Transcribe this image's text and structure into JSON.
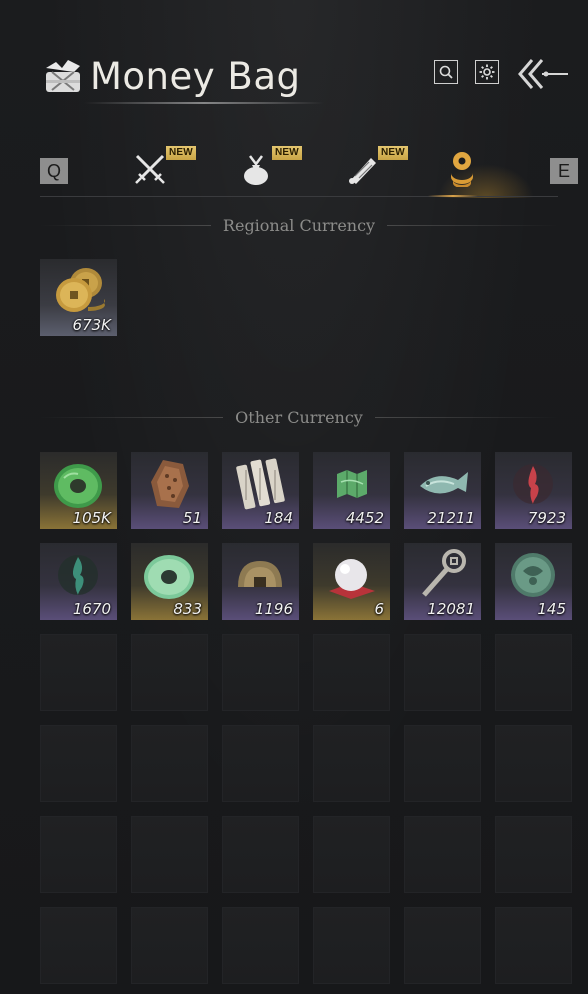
{
  "header": {
    "title": "Money Bag",
    "icons": {
      "bag": "money-bag-icon",
      "search": "search-icon",
      "settings": "gear-icon",
      "back": "back-arrows-icon"
    }
  },
  "tabs": {
    "prev_key": "Q",
    "next_key": "E",
    "items": [
      {
        "icon": "crossed-swords-icon",
        "badge": "NEW",
        "active": false
      },
      {
        "icon": "bundle-icon",
        "badge": "NEW",
        "active": false
      },
      {
        "icon": "scroll-icon",
        "badge": "NEW",
        "active": false
      },
      {
        "icon": "coin-stack-icon",
        "badge": "",
        "active": true
      }
    ],
    "accent": "#d9a24a"
  },
  "regional": {
    "title": "Regional Currency",
    "items": [
      {
        "icon": "copper-coins-icon",
        "count": "673K",
        "quality": "gray"
      }
    ]
  },
  "other": {
    "title": "Other Currency",
    "items": [
      {
        "icon": "jade-ring-icon",
        "count": "105K",
        "quality": "gold"
      },
      {
        "icon": "bronze-token-icon",
        "count": "51",
        "quality": "purple"
      },
      {
        "icon": "paper-slips-icon",
        "count": "184",
        "quality": "purple"
      },
      {
        "icon": "map-icon",
        "count": "4452",
        "quality": "purple"
      },
      {
        "icon": "jade-fish-icon",
        "count": "21211",
        "quality": "purple"
      },
      {
        "icon": "red-flame-icon",
        "count": "7923",
        "quality": "purple"
      },
      {
        "icon": "green-flame-icon",
        "count": "1670",
        "quality": "purple"
      },
      {
        "icon": "jade-disc-icon",
        "count": "833",
        "quality": "gold"
      },
      {
        "icon": "bronze-dome-icon",
        "count": "1196",
        "quality": "purple"
      },
      {
        "icon": "pearl-icon",
        "count": "6",
        "quality": "gold"
      },
      {
        "icon": "coin-sword-icon",
        "count": "12081",
        "quality": "purple"
      },
      {
        "icon": "jade-medallion-icon",
        "count": "145",
        "quality": "purple"
      }
    ],
    "empty_rows": 4
  },
  "colors": {
    "quality_gold": "#8a7337",
    "quality_purple": "#5a4e78",
    "new_badge": "#d8b85c"
  }
}
